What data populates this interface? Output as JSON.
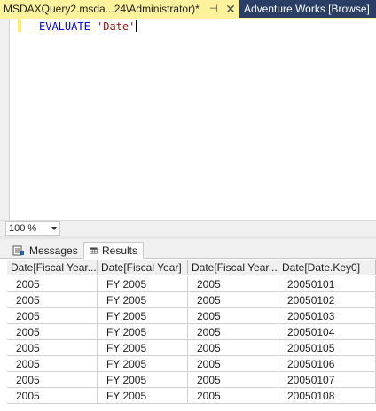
{
  "tabs": {
    "active_title": "MSDAXQuery2.msda...24\\Administrator)*",
    "inactive_title": "Adventure Works [Browse]"
  },
  "editor": {
    "keyword": "EVALUATE",
    "table_literal": "'Date'"
  },
  "zoom": {
    "value": "100 %"
  },
  "result_tabs": {
    "messages_label": "Messages",
    "results_label": "Results"
  },
  "grid": {
    "columns": [
      "Date[Fiscal Year...",
      "Date[Fiscal Year]",
      "Date[Fiscal Year...",
      "Date[Date.Key0]"
    ],
    "rows": [
      [
        "2005",
        "FY 2005",
        "2005",
        "20050101"
      ],
      [
        "2005",
        "FY 2005",
        "2005",
        "20050102"
      ],
      [
        "2005",
        "FY 2005",
        "2005",
        "20050103"
      ],
      [
        "2005",
        "FY 2005",
        "2005",
        "20050104"
      ],
      [
        "2005",
        "FY 2005",
        "2005",
        "20050105"
      ],
      [
        "2005",
        "FY 2005",
        "2005",
        "20050106"
      ],
      [
        "2005",
        "FY 2005",
        "2005",
        "20050107"
      ],
      [
        "2005",
        "FY 2005",
        "2005",
        "20050108"
      ]
    ]
  },
  "colors": {
    "tab_strip_bg": "#2b3f66",
    "active_tab_bg": "#fff29d",
    "keyword_color": "#0000ff",
    "string_color": "#a31515"
  }
}
